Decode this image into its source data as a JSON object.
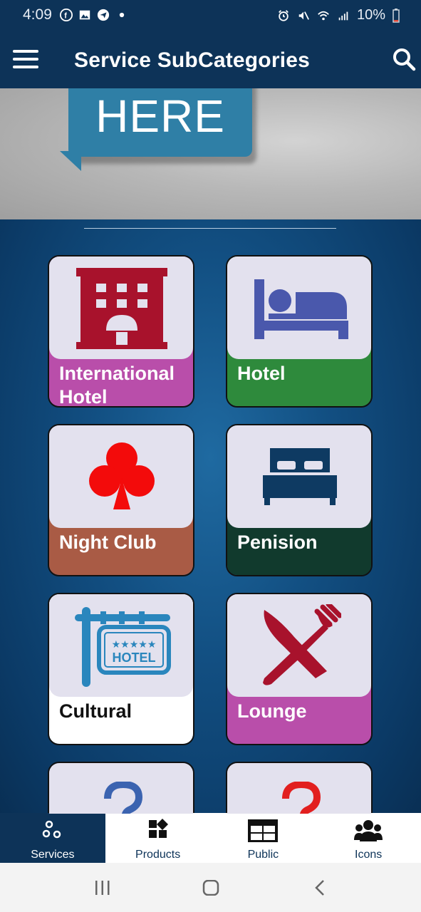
{
  "status_bar": {
    "time": "4:09",
    "battery": "10%",
    "left_icons": [
      "facebook-icon",
      "image-icon",
      "telegram-icon",
      "dot-icon"
    ],
    "right_icons": [
      "alarm-icon",
      "mute-icon",
      "wifi-icon",
      "signal-icon",
      "battery-icon"
    ]
  },
  "app_bar": {
    "title": "Service SubCategories",
    "menu_icon": "hamburger-menu-icon",
    "search_icon": "search-icon"
  },
  "banner": {
    "text": "HERE"
  },
  "tiles": [
    {
      "label": "International Hotel",
      "icon": "hotel-building-icon",
      "color": "#b94eaa"
    },
    {
      "label": "Hotel",
      "icon": "bed-person-icon",
      "color": "#2e8a3c"
    },
    {
      "label": "Night Club",
      "icon": "club-suit-icon",
      "color": "#a95b45"
    },
    {
      "label": "Penision",
      "icon": "double-bed-icon",
      "color": "#113a2d"
    },
    {
      "label": "Cultural",
      "icon": "hotel-sign-icon",
      "color": "#ffffff",
      "sign_text": "HOTEL",
      "stars": "★★★★★"
    },
    {
      "label": "Lounge",
      "icon": "knife-fork-icon",
      "color": "#b94eaa"
    },
    {
      "label": "",
      "icon": "question-mark-icon",
      "color": "#3b63b0"
    },
    {
      "label": "",
      "icon": "question-mark-icon",
      "color": "#e21f1f"
    }
  ],
  "bottom_nav": {
    "items": [
      {
        "label": "Services",
        "icon": "services-icon",
        "active": true
      },
      {
        "label": "Products",
        "icon": "products-icon",
        "active": false
      },
      {
        "label": "Public",
        "icon": "public-table-icon",
        "active": false
      },
      {
        "label": "Icons",
        "icon": "people-icon",
        "active": false
      }
    ]
  },
  "system_nav": [
    "recents-icon",
    "home-icon",
    "back-icon"
  ]
}
